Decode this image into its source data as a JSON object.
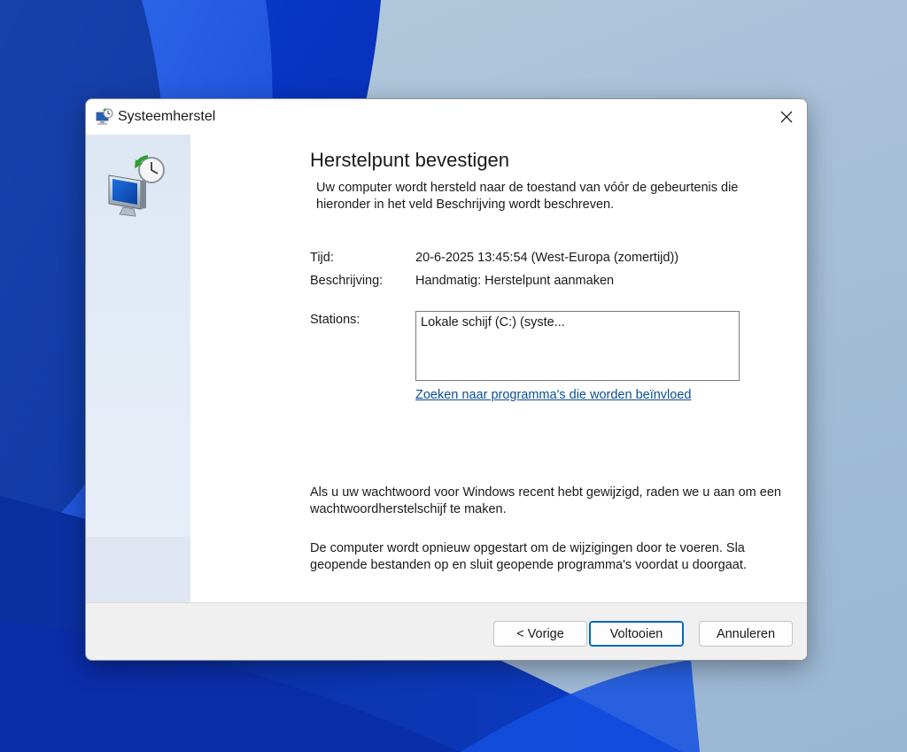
{
  "window": {
    "title": "Systeemherstel",
    "close_icon": "close-icon"
  },
  "page": {
    "heading": "Herstelpunt bevestigen",
    "intro": "Uw computer wordt hersteld naar de toestand van vóór de gebeurtenis die hieronder in het veld Beschrijving wordt beschreven.",
    "time_label": "Tijd:",
    "time_value": "20-6-2025 13:45:54 (West-Europa (zomertijd))",
    "description_label": "Beschrijving:",
    "description_value": "Handmatig: Herstelpunt aanmaken",
    "stations_label": "Stations:",
    "stations": [
      "Lokale schijf (C:) (syste..."
    ],
    "affected_programs_link": "Zoeken naar programma's die worden beïnvloed",
    "password_note": "Als u uw wachtwoord voor Windows recent hebt gewijzigd, raden we u aan om een wachtwoordherstelschijf te maken.",
    "restart_note": "De computer wordt opnieuw opgestart om de wijzigingen door te voeren. Sla geopende bestanden op en sluit geopende programma's voordat u doorgaat."
  },
  "buttons": {
    "back": "< Vorige",
    "finish": "Voltooien",
    "cancel": "Annuleren"
  },
  "colors": {
    "accent": "#0067c0",
    "link": "#0b4f94",
    "side_panel": "#dde7f4",
    "footer": "#f0f0f0"
  },
  "icons": {
    "app": "system-restore-icon",
    "side": "system-restore-large-icon"
  }
}
